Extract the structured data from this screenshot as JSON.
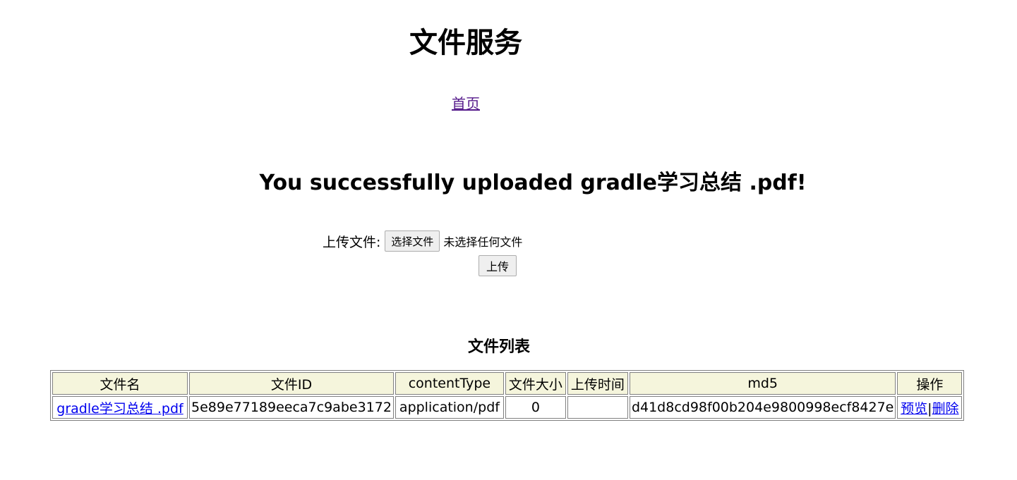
{
  "header": {
    "title": "文件服务"
  },
  "nav": {
    "home_link": "首页"
  },
  "message": "You successfully uploaded gradle学习总结 .pdf!",
  "upload_form": {
    "label": "上传文件:",
    "choose_button": "选择文件",
    "no_file_status": "未选择任何文件",
    "submit_button": "上传"
  },
  "file_list": {
    "title": "文件列表",
    "columns": [
      "文件名",
      "文件ID",
      "contentType",
      "文件大小",
      "上传时间",
      "md5",
      "操作"
    ],
    "rows": [
      {
        "name": "gradle学习总结 .pdf",
        "id": "5e89e77189eeca7c9abe3172",
        "content_type": "application/pdf",
        "size": "0",
        "upload_time": "",
        "md5": "d41d8cd98f00b204e9800998ecf8427e",
        "preview_link": "预览",
        "separator": "|",
        "delete_link": "删除"
      }
    ]
  }
}
